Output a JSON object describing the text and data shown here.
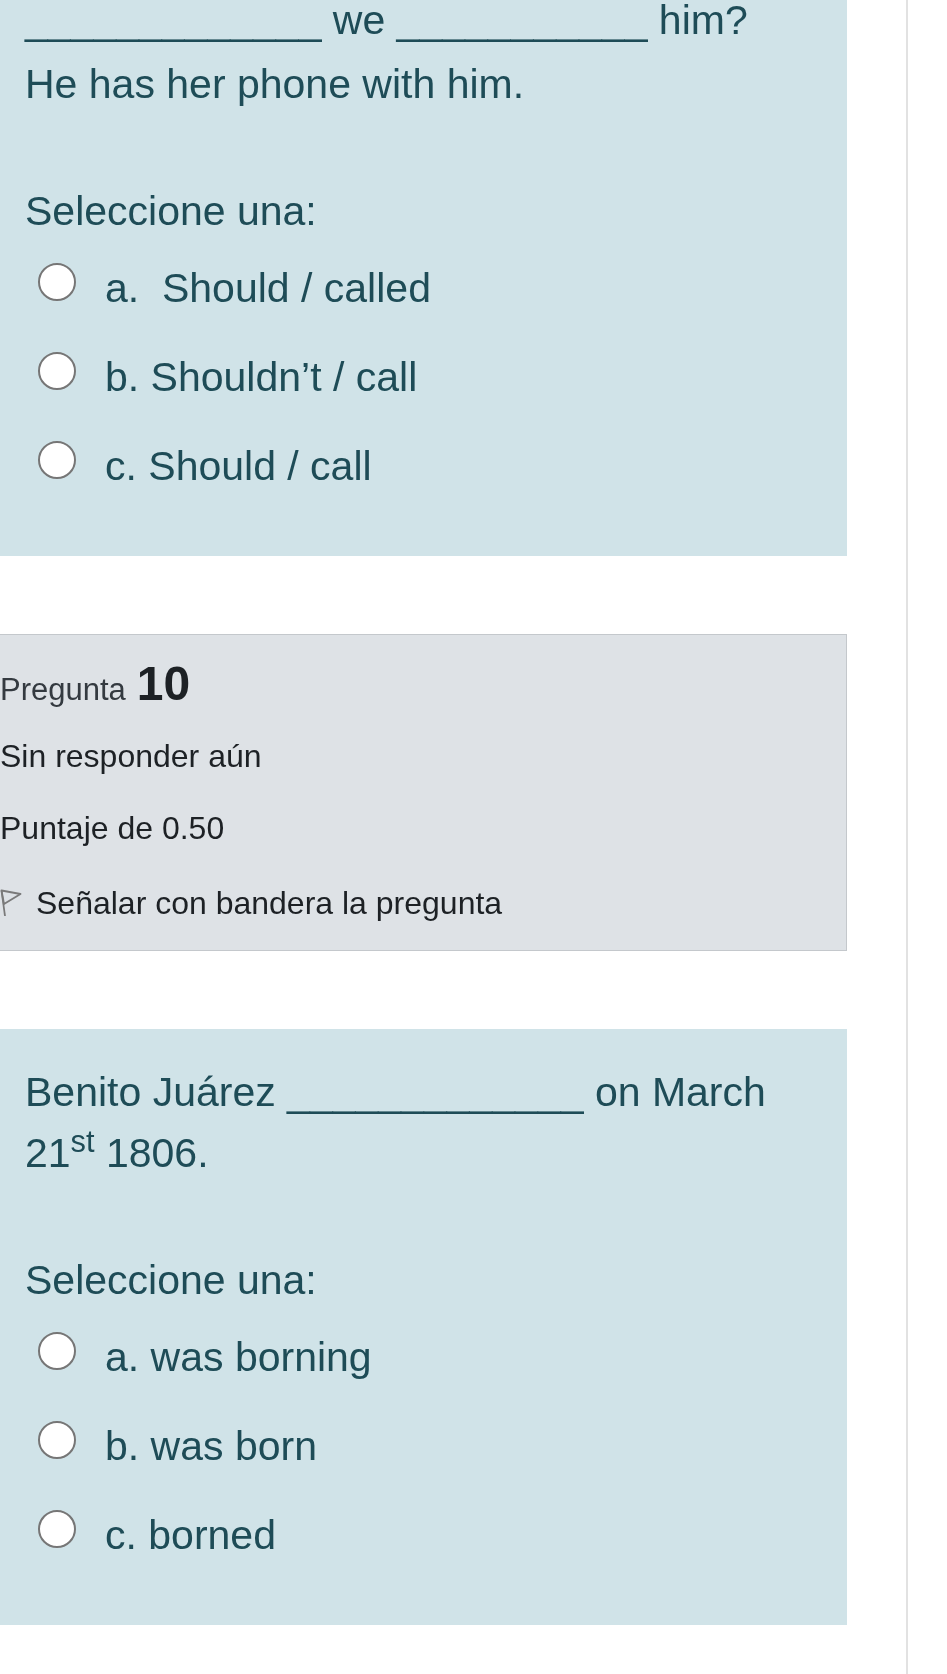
{
  "sections": [
    {
      "kind": "question",
      "lines": [
        "_____________ we ___________ him?",
        "He has her phone with him."
      ],
      "prompt": "Seleccione una:",
      "options": [
        {
          "label": "a.  Should / called",
          "selected": false
        },
        {
          "label": "b. Shouldn’t / call",
          "selected": false
        },
        {
          "label": "c. Should / call",
          "selected": false
        }
      ]
    },
    {
      "kind": "info",
      "label": "Pregunta",
      "number": "10",
      "status": "Sin responder aún",
      "grade": "Puntaje de 0.50",
      "flag": {
        "label": "Señalar con bandera la pregunta",
        "flagged": false
      }
    },
    {
      "kind": "question",
      "lines": [
        "Benito Juárez _____________ on March 21$^{st}$ 1806."
      ],
      "prompt": "Seleccione una:",
      "options": [
        {
          "label": "a. was borning",
          "selected": false
        },
        {
          "label": "b. was born",
          "selected": false
        },
        {
          "label": "c. borned",
          "selected": false
        }
      ]
    }
  ]
}
